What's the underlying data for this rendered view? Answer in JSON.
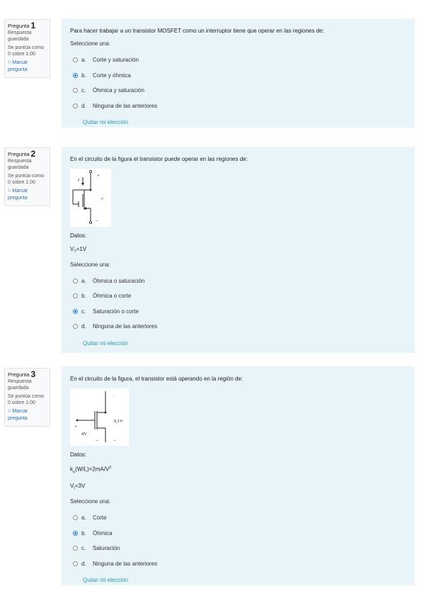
{
  "questions": [
    {
      "number_label": "Pregunta",
      "number": "1",
      "state": "Respuesta guardada",
      "grade": "Se puntúa como 0 sobre 1.00",
      "flag": "Marcar pregunta",
      "text": "Para hacer trabajar a un transistor MOSFET como un interruptor tiene que operar en las regiones de:",
      "prompt": "Seleccione una:",
      "options": [
        {
          "letter": "a.",
          "label": "Corte y saturación",
          "selected": false
        },
        {
          "letter": "b.",
          "label": "Corte y óhmica",
          "selected": true
        },
        {
          "letter": "c.",
          "label": "Óhmica y saturación",
          "selected": false
        },
        {
          "letter": "d.",
          "label": "Ninguna de las anteriores",
          "selected": false
        }
      ],
      "clear": "Quitar mi elección"
    },
    {
      "number_label": "Pregunta",
      "number": "2",
      "state": "Respuesta guardada",
      "grade": "Se puntúa como 0 sobre 1.00",
      "flag": "Marcar pregunta",
      "text": "En el circuito de la figura el transistor puede operar en las regiones de:",
      "figure_labels": {
        "current": "I",
        "plus": "+",
        "v": "v",
        "minus": "−"
      },
      "datos_label": "Datos:",
      "datos": [
        {
          "sym": "V",
          "sub": "T",
          "rest": "=1V"
        }
      ],
      "prompt": "Seleccione una:",
      "options": [
        {
          "letter": "a.",
          "label": "Óhmica o saturación",
          "selected": false
        },
        {
          "letter": "b.",
          "label": "Óhmica o corte",
          "selected": false
        },
        {
          "letter": "c.",
          "label": "Saturación o corte",
          "selected": true
        },
        {
          "letter": "d.",
          "label": "Ninguna de las anteriores",
          "selected": false
        }
      ],
      "clear": "Quitar mi elección"
    },
    {
      "number_label": "Pregunta",
      "number": "3",
      "state": "Respuesta guardada",
      "grade": "Se puntúa como 0 sobre 1.00",
      "flag": "Marcar pregunta",
      "text": "En el circuito de la figura, el transistor está operando en la región de:",
      "figure_labels": {
        "vgs": "4V",
        "vds": "0,1V",
        "plus": "+",
        "minus": "−",
        "plus2": "+",
        "minus2": "−"
      },
      "datos_label": "Datos:",
      "datos": [
        {
          "sym": "k",
          "sub": "n",
          "rest": "(W/L)=2mA/V",
          "sup": "2"
        },
        {
          "sym": "V",
          "sub": "t",
          "rest": "=3V"
        }
      ],
      "prompt": "Seleccione una:",
      "options": [
        {
          "letter": "a.",
          "label": "Corte",
          "selected": false
        },
        {
          "letter": "b.",
          "label": "Óhmica",
          "selected": true
        },
        {
          "letter": "c.",
          "label": "Saturación",
          "selected": false
        },
        {
          "letter": "d.",
          "label": "Ninguna de las anteriores",
          "selected": false
        }
      ],
      "clear": "Quitar mi elección"
    }
  ]
}
